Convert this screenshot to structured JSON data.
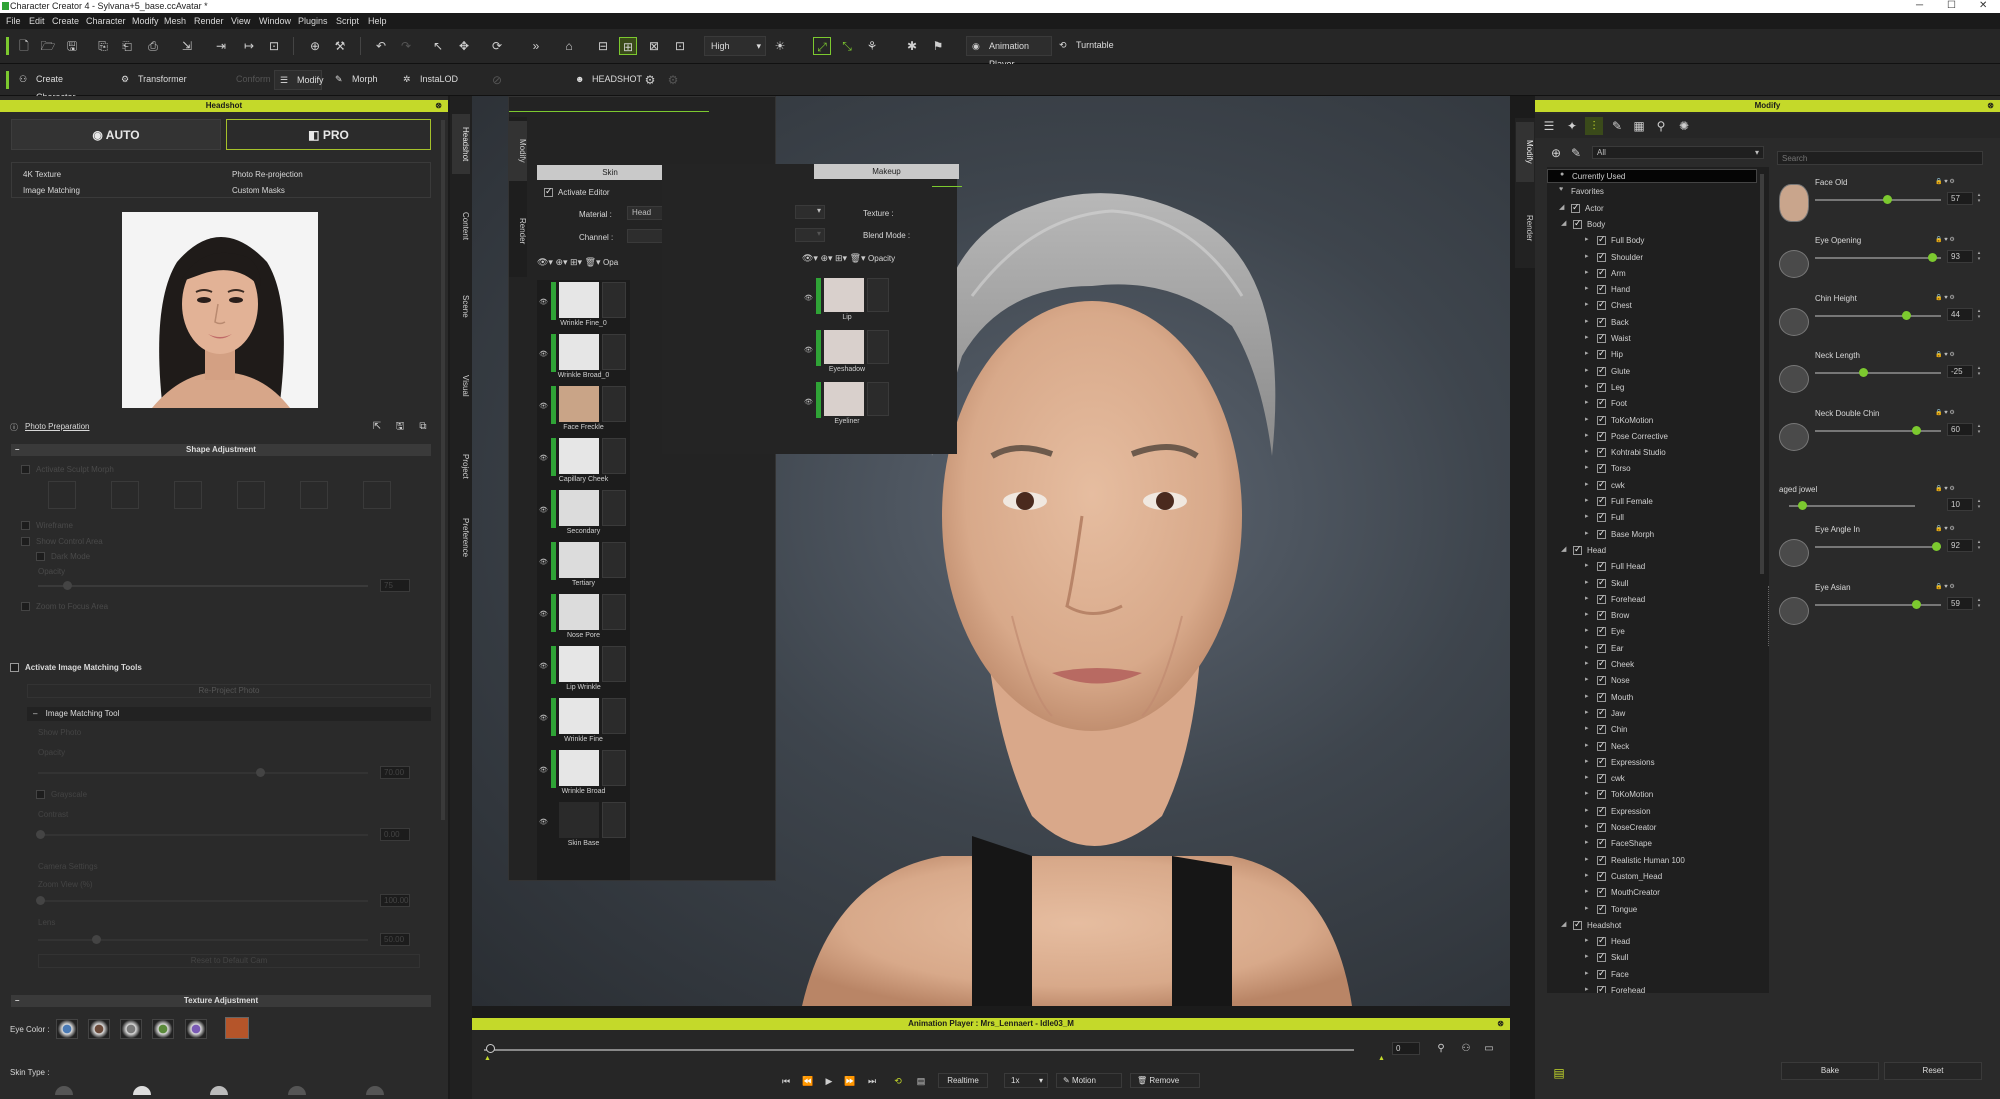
{
  "window": {
    "title": "Character Creator 4 - Sylvana+5_base.ccAvatar *",
    "min": "─",
    "max": "☐",
    "close": "✕"
  },
  "menus": [
    "File",
    "Edit",
    "Create",
    "Character",
    "Modify",
    "Mesh",
    "Render",
    "View",
    "Window",
    "Plugins",
    "Script",
    "Help"
  ],
  "toolbar": {
    "quality": "High",
    "animation_player": "Animation Player",
    "turntable": "Turntable"
  },
  "toolbar2": {
    "create_character": "Create Character",
    "transformer": "Transformer",
    "conform": "Conform",
    "modify": "Modify",
    "morph": "Morph",
    "instalod": "InstaLOD",
    "headshot": "HEADSHOT"
  },
  "headshot": {
    "title": "Headshot",
    "auto": "AUTO",
    "pro": "PRO",
    "options": [
      "4K Texture",
      "Photo Re-projection",
      "Image Matching",
      "Custom Masks"
    ],
    "photo_prep": "Photo Preparation",
    "shape_adjustment": "Shape Adjustment",
    "shape_items": [
      "Activate Sculpt Morph",
      "Wireframe",
      "Show Control Area",
      "Dark Mode",
      "Opacity",
      "Zoom to Focus Area"
    ],
    "opacity_value": "75",
    "activate_image_matching": "Activate Image Matching Tools",
    "reproject": "Re-Project Photo",
    "image_matching_tool": "Image Matching Tool",
    "imt_items": [
      "Show Photo",
      "Opacity",
      "Grayscale",
      "Contrast",
      "Camera Settings",
      "Zoom View (%)",
      "Lens",
      "Reset to Default Cam"
    ],
    "imt_values": [
      "70.00",
      "0.00",
      "100.00",
      "50.00"
    ],
    "texture_adjustment": "Texture Adjustment",
    "eye_color": "Eye Color :",
    "skin_type": "Skin Type :",
    "eye_swatch": "#b5552a"
  },
  "side_tabs_left": [
    "Headshot",
    "Content",
    "Scene",
    "Visual",
    "Project",
    "Preference"
  ],
  "side_tabs_mid": [
    "Modify",
    "Render"
  ],
  "skin_editor": {
    "skin_tab": "Skin",
    "makeup_tab": "Makeup",
    "activate_editor": "Activate Editor",
    "material_label": "Material :",
    "material_value": "Head",
    "channel_label": "Channel :",
    "texture_label": "Texture :",
    "blend_label": "Blend Mode :",
    "opacity_short": "Opa",
    "opacity": "Opacity",
    "skin_layers": [
      "Wrinkle Fine_0",
      "Wrinkle Broad_0",
      "Face Freckle",
      "Capillary Cheek",
      "Secondary",
      "Tertiary",
      "Nose Pore",
      "Lip Wrinkle",
      "Wrinkle Fine",
      "Wrinkle Broad",
      "Skin Base"
    ],
    "makeup_layers": [
      "Lip",
      "Eyeshadow",
      "Eyeliner"
    ]
  },
  "animation": {
    "title": "Animation Player : Mrs_Lennaert - Idle03_M",
    "frame": "0",
    "realtime": "Realtime",
    "speed": "1x",
    "motion": "Motion",
    "remove": "Remove"
  },
  "modify": {
    "title": "Modify",
    "filter": "All",
    "search_placeholder": "Search",
    "tree": [
      {
        "label": "Currently Used",
        "level": 0
      },
      {
        "label": "Favorites",
        "level": 0
      },
      {
        "label": "Actor",
        "level": 0
      },
      {
        "label": "Body",
        "level": 1
      },
      {
        "label": "Full Body",
        "level": 2
      },
      {
        "label": "Shoulder",
        "level": 2
      },
      {
        "label": "Arm",
        "level": 2
      },
      {
        "label": "Hand",
        "level": 2
      },
      {
        "label": "Chest",
        "level": 2
      },
      {
        "label": "Back",
        "level": 2
      },
      {
        "label": "Waist",
        "level": 2
      },
      {
        "label": "Hip",
        "level": 2
      },
      {
        "label": "Glute",
        "level": 2
      },
      {
        "label": "Leg",
        "level": 2
      },
      {
        "label": "Foot",
        "level": 2
      },
      {
        "label": "ToKoMotion",
        "level": 2
      },
      {
        "label": "Pose Corrective",
        "level": 2
      },
      {
        "label": "Kohtrabi Studio",
        "level": 2
      },
      {
        "label": "Torso",
        "level": 2
      },
      {
        "label": "cwk",
        "level": 2
      },
      {
        "label": "Full Female",
        "level": 2
      },
      {
        "label": "Full",
        "level": 2
      },
      {
        "label": "Base Morph",
        "level": 2
      },
      {
        "label": "Head",
        "level": 1
      },
      {
        "label": "Full Head",
        "level": 2
      },
      {
        "label": "Skull",
        "level": 2
      },
      {
        "label": "Forehead",
        "level": 2
      },
      {
        "label": "Brow",
        "level": 2
      },
      {
        "label": "Eye",
        "level": 2
      },
      {
        "label": "Ear",
        "level": 2
      },
      {
        "label": "Cheek",
        "level": 2
      },
      {
        "label": "Nose",
        "level": 2
      },
      {
        "label": "Mouth",
        "level": 2
      },
      {
        "label": "Jaw",
        "level": 2
      },
      {
        "label": "Chin",
        "level": 2
      },
      {
        "label": "Neck",
        "level": 2
      },
      {
        "label": "Expressions",
        "level": 2
      },
      {
        "label": "cwk",
        "level": 2
      },
      {
        "label": "ToKoMotion",
        "level": 2
      },
      {
        "label": "Expression",
        "level": 2
      },
      {
        "label": "NoseCreator",
        "level": 2
      },
      {
        "label": "FaceShape",
        "level": 2
      },
      {
        "label": "Realistic Human 100",
        "level": 2
      },
      {
        "label": "Custom_Head",
        "level": 2
      },
      {
        "label": "MouthCreator",
        "level": 2
      },
      {
        "label": "Tongue",
        "level": 2
      },
      {
        "label": "Headshot",
        "level": 1
      },
      {
        "label": "Head",
        "level": 2
      },
      {
        "label": "Skull",
        "level": 2
      },
      {
        "label": "Face",
        "level": 2
      },
      {
        "label": "Forehead",
        "level": 2
      },
      {
        "label": "Brow",
        "level": 2
      },
      {
        "label": "Eye",
        "level": 2
      },
      {
        "label": "Ear",
        "level": 2
      },
      {
        "label": "Cheek",
        "level": 2
      }
    ],
    "sliders": [
      {
        "label": "Face Old",
        "value": "57",
        "pos": 0.57
      },
      {
        "label": "Eye Opening",
        "value": "93",
        "pos": 0.93
      },
      {
        "label": "Chin Height",
        "value": "44",
        "pos": 0.72
      },
      {
        "label": "Neck Length",
        "value": "-25",
        "pos": 0.38
      },
      {
        "label": "Neck Double Chin",
        "value": "60",
        "pos": 0.8
      },
      {
        "label": "aged jowel",
        "value": "10",
        "pos": 0.1
      },
      {
        "label": "Eye Angle In",
        "value": "92",
        "pos": 0.96
      },
      {
        "label": "Eye Asian",
        "value": "59",
        "pos": 0.8
      }
    ],
    "bake": "Bake",
    "reset": "Reset"
  }
}
